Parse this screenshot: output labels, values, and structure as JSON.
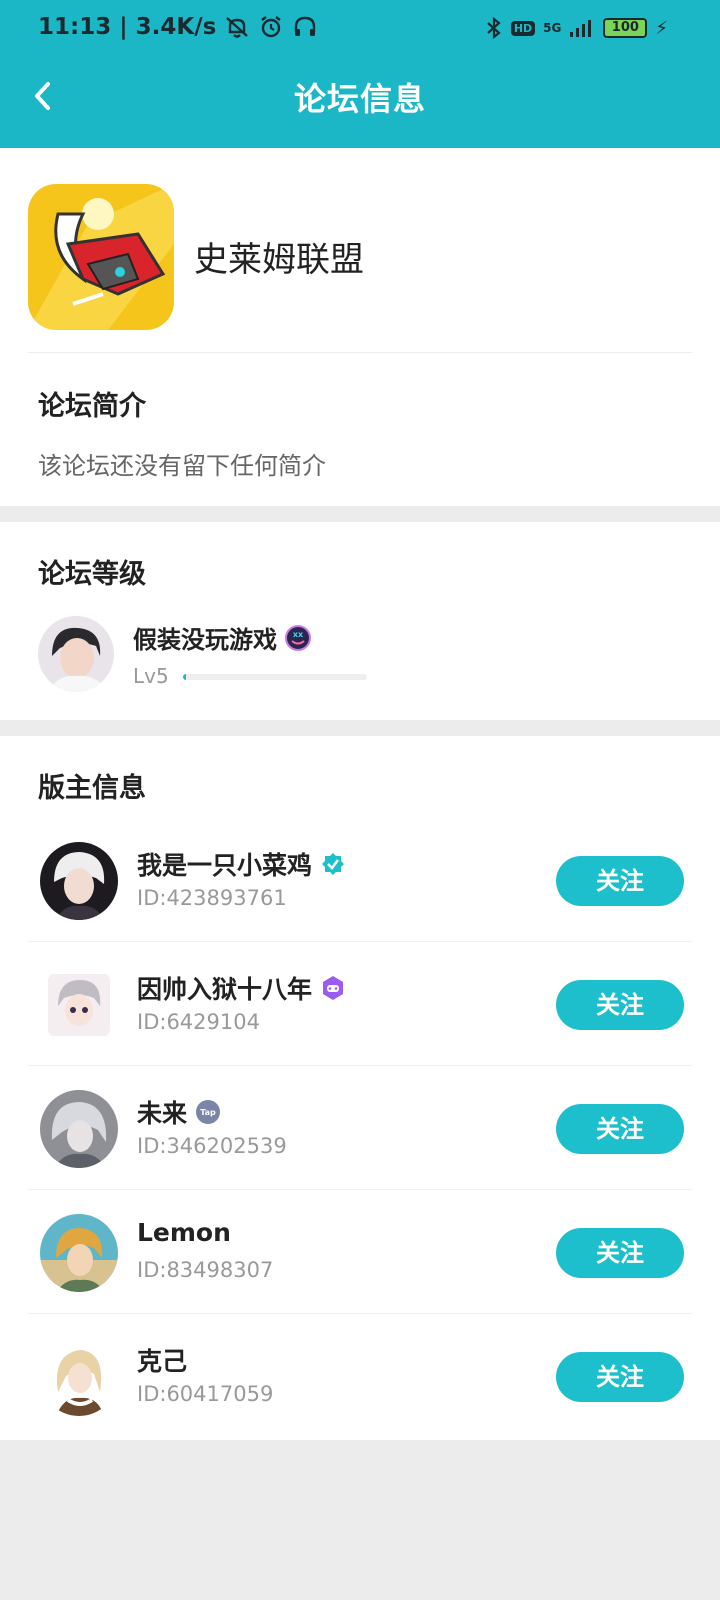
{
  "status": {
    "time": "11:13",
    "speed": "3.4K/s",
    "hd": "HD",
    "net": "5G",
    "battery": "100"
  },
  "nav": {
    "title": "论坛信息"
  },
  "forum": {
    "name": "史莱姆联盟",
    "intro_title": "论坛简介",
    "intro_text": "该论坛还没有留下任何简介"
  },
  "level": {
    "title": "论坛等级",
    "user_name": "假装没玩游戏",
    "level_label": "Lv5",
    "progress": 0.01
  },
  "moderators": {
    "title": "版主信息",
    "follow_label": "关注",
    "items": [
      {
        "name": "我是一只小菜鸡",
        "id": "ID:423893761",
        "badge": "verified-icon"
      },
      {
        "name": "因帅入狱十八年",
        "id": "ID:6429104",
        "badge": "gamepad-badge-icon"
      },
      {
        "name": "未来",
        "id": "ID:346202539",
        "badge": "tap-badge-icon"
      },
      {
        "name": "Lemon",
        "id": "ID:83498307",
        "badge": ""
      },
      {
        "name": "克己",
        "id": "ID:60417059",
        "badge": ""
      }
    ]
  },
  "colors": {
    "accent": "#1cb7c6",
    "button": "#1cbfcb",
    "page_bg": "#ececec"
  }
}
